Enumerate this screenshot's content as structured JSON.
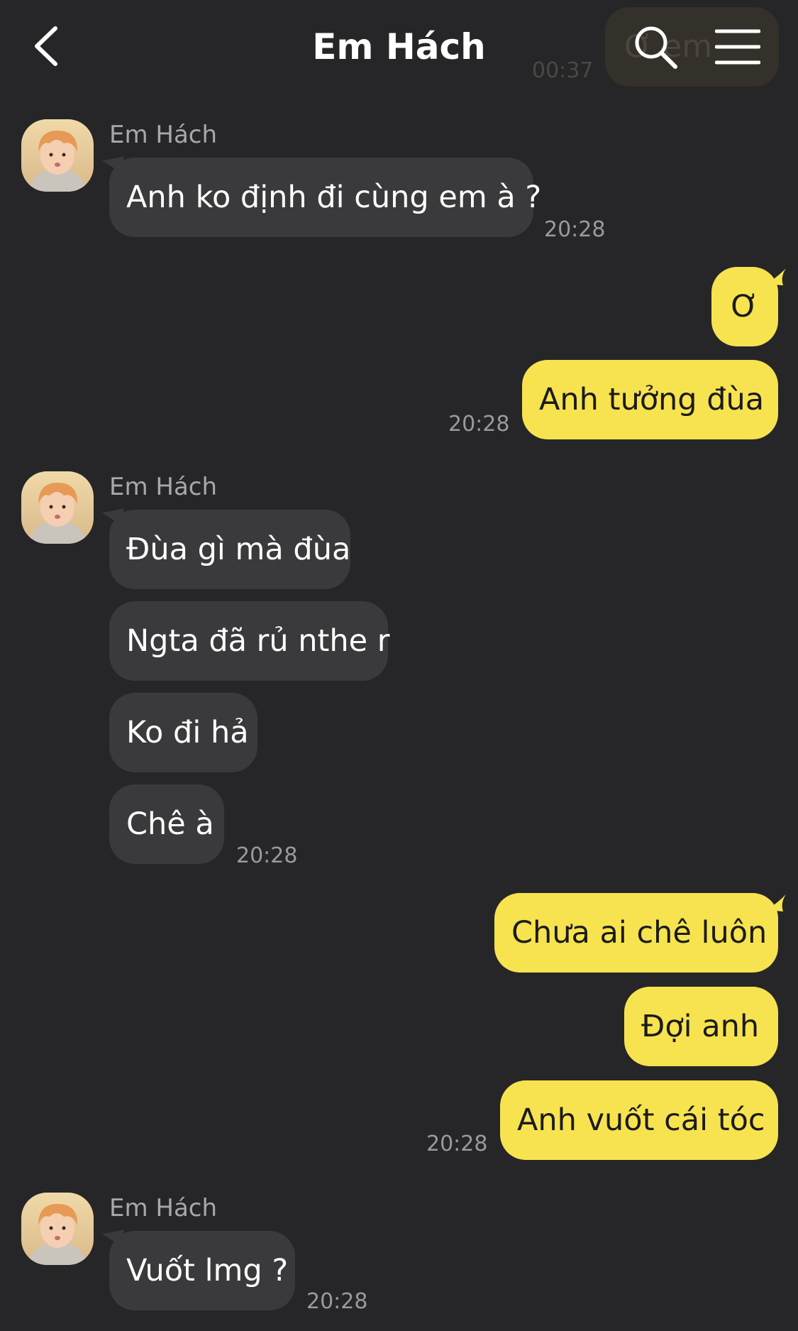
{
  "header": {
    "title": "Em Hách",
    "pinned_time": "00:37",
    "pinned_text": "Ơ em"
  },
  "colors": {
    "background": "#262628",
    "incoming_bubble": "#3a3a3c",
    "outgoing_bubble": "#f7e34f"
  },
  "icons": {
    "back": "chevron-left-icon",
    "search": "search-icon",
    "menu": "menu-icon"
  },
  "messages": {
    "g1": {
      "sender": "Em Hách",
      "texts": [
        "Anh ko định đi cùng em à ?"
      ],
      "time": "20:28"
    },
    "g2": {
      "texts": [
        "Ơ",
        "Anh tưởng đùa"
      ],
      "time": "20:28"
    },
    "g3": {
      "sender": "Em Hách",
      "texts": [
        "Đùa gì mà đùa",
        "Ngta đã rủ nthe r",
        "Ko đi hả",
        "Chê à"
      ],
      "time": "20:28"
    },
    "g4": {
      "texts": [
        "Chưa ai chê luôn",
        "Đợi anh",
        "Anh vuốt cái tóc"
      ],
      "time": "20:28"
    },
    "g5": {
      "sender": "Em Hách",
      "texts": [
        "Vuốt lmg ?"
      ],
      "time": "20:28"
    }
  }
}
